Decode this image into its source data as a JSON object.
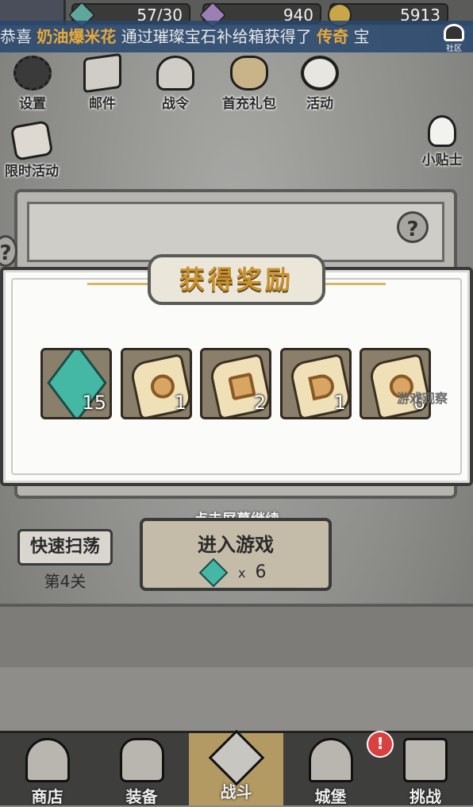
{
  "resources": {
    "energy": "57/30",
    "gems": "940",
    "coins": "5913"
  },
  "notice": {
    "prefix": "恭喜",
    "player": "奶油爆米花",
    "middle": "通过璀璨宝石补给箱获得了",
    "rarity": "传奇",
    "suffix": "宝"
  },
  "community_label": "社区",
  "menu": {
    "settings": "设置",
    "mail": "邮件",
    "battle_pass": "战令",
    "first_recharge": "首充礼包",
    "events": "活动",
    "limited_events": "限时活动",
    "tips": "小贴士"
  },
  "popup": {
    "title": "获得奖励",
    "rewards": [
      {
        "icon": "energy-gem-icon",
        "count": "15"
      },
      {
        "icon": "scroll-ring-icon",
        "count": "1"
      },
      {
        "icon": "scroll-boots-icon",
        "count": "2"
      },
      {
        "icon": "scroll-necklace-icon",
        "count": "1"
      },
      {
        "icon": "scroll-gear-icon",
        "count": "6"
      }
    ]
  },
  "watermark": "游戏观察",
  "continue_hint": "点击屏幕继续",
  "quick_sweep": "快速扫荡",
  "level": "第4关",
  "enter_game": "进入游戏",
  "enter_cost": {
    "x": "x",
    "value": "6"
  },
  "badge": "!",
  "nav": {
    "shop": "商店",
    "equipment": "装备",
    "battle": "战斗",
    "castle": "城堡",
    "challenge": "挑战"
  },
  "colors": {
    "title_gold": "#c9922f",
    "gem_teal": "#45b8a5",
    "highlight_orange": "#e7a93a",
    "badge_red": "#d94040"
  }
}
